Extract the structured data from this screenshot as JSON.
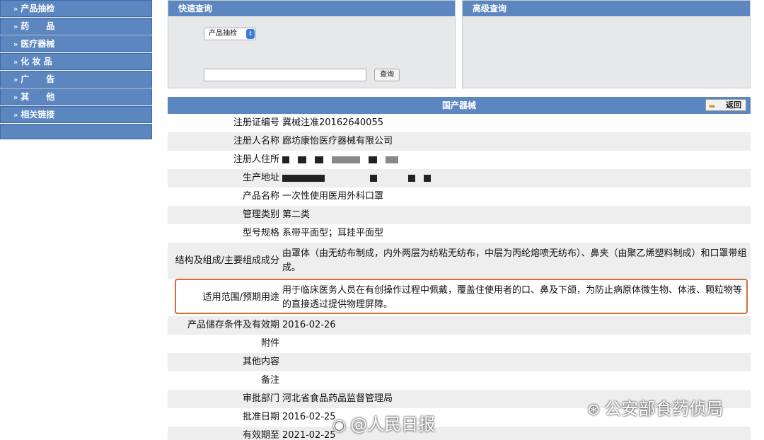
{
  "sidebar": {
    "items": [
      {
        "label": "产品抽检"
      },
      {
        "label": "药　　品"
      },
      {
        "label": "医疗器械"
      },
      {
        "label": "化 妆 品"
      },
      {
        "label": "广　　告"
      },
      {
        "label": "其　　他"
      },
      {
        "label": "相关链接"
      }
    ]
  },
  "quick_search": {
    "title": "快速查询",
    "select_value": "产品抽检",
    "input_value": "",
    "button_label": "查询"
  },
  "advanced_search": {
    "title": "高级查询"
  },
  "detail": {
    "title": "国产器械",
    "back_label": "返回",
    "rows": [
      {
        "label": "注册证编号",
        "value": "冀械注准20162640055"
      },
      {
        "label": "注册人名称",
        "value": "廊坊康怡医疗器械有限公司"
      },
      {
        "label": "注册人住所",
        "value": "[redacted]"
      },
      {
        "label": "生产地址",
        "value": "[redacted]"
      },
      {
        "label": "产品名称",
        "value": "一次性使用医用外科口罩"
      },
      {
        "label": "管理类别",
        "value": "第二类"
      },
      {
        "label": "型号规格",
        "value": "系带平面型；耳挂平面型"
      },
      {
        "label": "结构及组成/主要组成成分",
        "value": "由罩体（由无纺布制成，内外两层为纺粘无纺布，中层为丙纶熔喷无纺布）、鼻夹（由聚乙烯塑料制成）和口罩带组成。"
      },
      {
        "label": "适用范围/预期用途",
        "value": "用于临床医务人员在有创操作过程中佩戴，覆盖住使用者的口、鼻及下颌，为防止病原体微生物、体液、颗粒物等的直接透过提供物理屏障。"
      },
      {
        "label": "产品储存条件及有效期",
        "value": "2016-02-26"
      },
      {
        "label": "附件",
        "value": ""
      },
      {
        "label": "其他内容",
        "value": ""
      },
      {
        "label": "备注",
        "value": ""
      },
      {
        "label": "审批部门",
        "value": "河北省食品药品监督管理局"
      },
      {
        "label": "批准日期",
        "value": "2016-02-25"
      },
      {
        "label": "有效期至",
        "value": "2021-02-25"
      }
    ]
  },
  "watermarks": {
    "primary": "公安部食药侦局",
    "secondary": "@人民日报"
  }
}
